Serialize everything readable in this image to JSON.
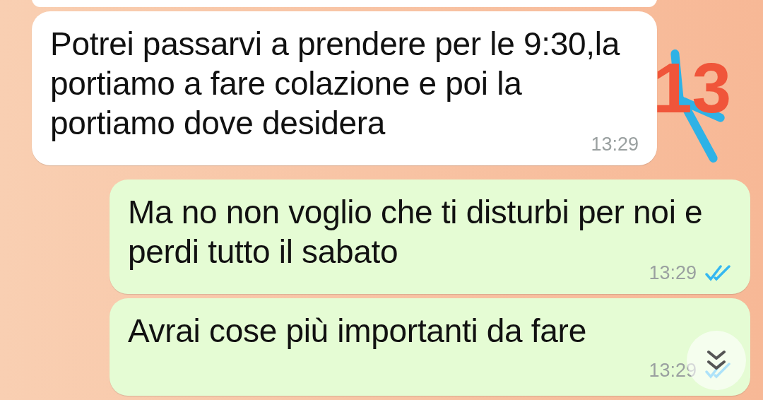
{
  "messages": [
    {
      "kind": "incoming",
      "text": "Potrei passarvi a prendere per le 9:30,la portiamo a fare colazione e poi la portiamo dove desidera",
      "time": "13:29"
    },
    {
      "kind": "outgoing",
      "text": "Ma no non voglio che ti disturbi per noi e perdi tutto il sabato",
      "time": "13:29",
      "read": true
    },
    {
      "kind": "outgoing",
      "text": "Avrai cose più importanti da fare",
      "time": "13:29",
      "read": true
    }
  ],
  "annotation": {
    "text": "13",
    "color": "#f0553a"
  }
}
